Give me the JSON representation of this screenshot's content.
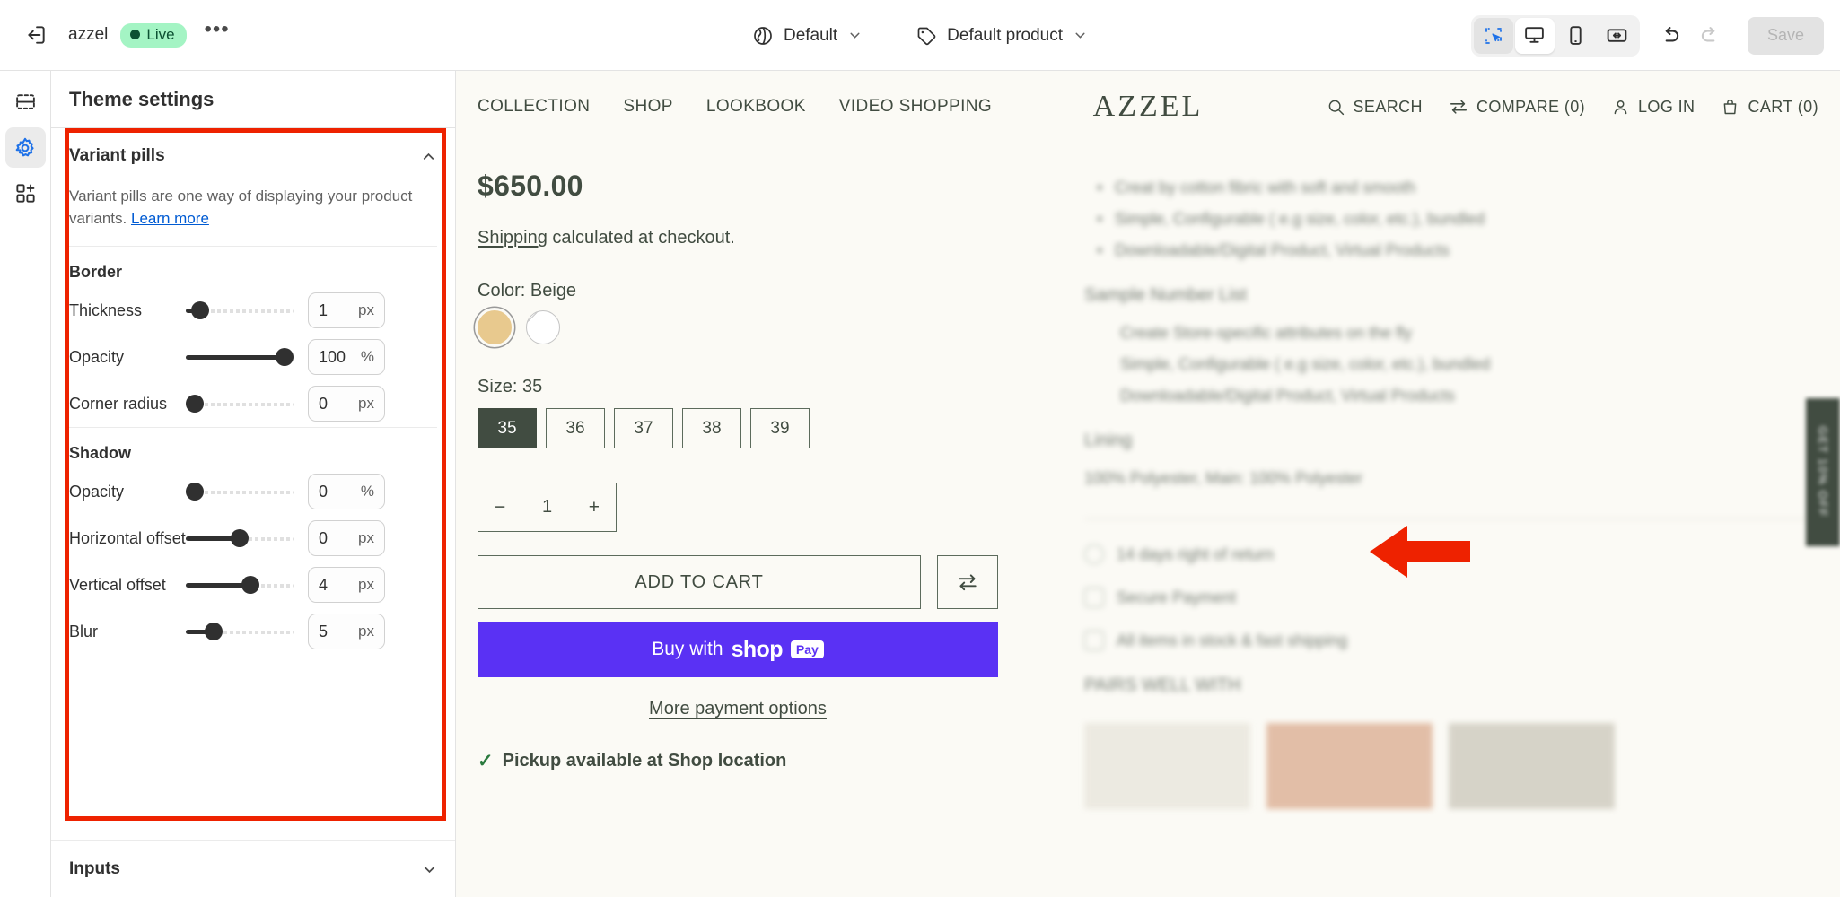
{
  "topbar": {
    "exit_icon": "exit-icon",
    "shop_name": "azzel",
    "live_label": "Live",
    "more_label": "•••",
    "theme_selector": {
      "icon": "globe-icon",
      "label": "Default",
      "chevron": "chevron-down-icon"
    },
    "template_selector": {
      "icon": "tag-icon",
      "label": "Default product",
      "chevron": "chevron-down-icon"
    },
    "view_buttons": [
      {
        "name": "inspect-icon",
        "state": "active"
      },
      {
        "name": "desktop-icon",
        "state": "selected"
      },
      {
        "name": "mobile-icon",
        "state": "default"
      },
      {
        "name": "fullwidth-icon",
        "state": "default"
      }
    ],
    "undo_icon": "undo-icon",
    "redo_icon": "redo-icon",
    "save_label": "Save",
    "save_disabled": true
  },
  "rail": {
    "items": [
      {
        "name": "sections-icon",
        "active": false
      },
      {
        "name": "gear-icon",
        "active": true
      },
      {
        "name": "apps-add-icon",
        "active": false
      }
    ]
  },
  "panel": {
    "title": "Theme settings",
    "section": {
      "title": "Variant pills",
      "collapse_icon": "chevron-up-icon",
      "description_before": "Variant pills are one way of displaying your product variants. ",
      "learn_more": "Learn more",
      "groups": [
        {
          "label": "Border",
          "rows": [
            {
              "label": "Thickness",
              "value": "1",
              "unit": "px",
              "fill_pct": 13
            },
            {
              "label": "Opacity",
              "value": "100",
              "unit": "%",
              "fill_pct": 100
            },
            {
              "label": "Corner radius",
              "value": "0",
              "unit": "px",
              "fill_pct": 0
            }
          ]
        },
        {
          "label": "Shadow",
          "rows": [
            {
              "label": "Opacity",
              "value": "0",
              "unit": "%",
              "fill_pct": 0
            },
            {
              "label": "Horizontal offset",
              "value": "0",
              "unit": "px",
              "fill_pct": 50
            },
            {
              "label": "Vertical offset",
              "value": "4",
              "unit": "px",
              "fill_pct": 60
            },
            {
              "label": "Blur",
              "value": "5",
              "unit": "px",
              "fill_pct": 26
            }
          ]
        }
      ]
    },
    "next_section": {
      "title": "Inputs",
      "expand_icon": "chevron-down-icon"
    }
  },
  "annotations": {
    "highlight_box_color": "#ee2200",
    "arrow_color": "#ee2200",
    "arrow_points_to": "size-pills"
  },
  "store": {
    "nav": [
      "COLLECTION",
      "SHOP",
      "LOOKBOOK",
      "VIDEO SHOPPING"
    ],
    "logo": "AZZEL",
    "utilities": [
      {
        "icon": "search-icon",
        "label": "SEARCH"
      },
      {
        "icon": "compare-icon",
        "label": "COMPARE (0)"
      },
      {
        "icon": "user-icon",
        "label": "LOG IN"
      },
      {
        "icon": "bag-icon",
        "label": "CART (0)"
      }
    ],
    "product": {
      "price": "$650.00",
      "shipping_link": "Shipping",
      "shipping_rest": " calculated at checkout.",
      "color_label": "Color: Beige",
      "color_swatches": [
        {
          "name": "beige-swatch",
          "color": "#e8c98e",
          "selected": true
        },
        {
          "name": "unavailable-swatch",
          "color": "#ffffff",
          "selected": false
        }
      ],
      "size_label": "Size: 35",
      "sizes": [
        "35",
        "36",
        "37",
        "38",
        "39"
      ],
      "selected_size": "35",
      "qty_minus": "−",
      "qty_value": "1",
      "qty_plus": "+",
      "add_to_cart": "ADD TO CART",
      "compare_icon": "compare-arrows-icon",
      "shoppay_prefix": "Buy with",
      "shoppay_logo": "shop",
      "shoppay_tag": "Pay",
      "more_payment": "More payment options",
      "pickup_check": "✓",
      "pickup_text": "Pickup available at Shop location"
    },
    "description_blurred": {
      "bullets": [
        "Creat by cotton fibric with soft and smooth",
        "Simple, Configurable ( e.g size, color, etc.), bundled",
        "Downloadable/Digital Product, Virtual Products"
      ],
      "list_heading": "Sample Number List",
      "numbered": [
        "Create Store-specific attributes on the fly",
        "Simple, Configurable ( e.g size, color, etc.), bundled",
        "Downloadable/Digital Product, Virtual Products"
      ],
      "lining_heading": "Lining",
      "lining_text": "100% Polyester, Main: 100% Polyester",
      "features": [
        "14 days right of return",
        "Secure Payment",
        "All items in stock & fast shipping"
      ],
      "pairs_heading": "PAIRS WELL WITH",
      "side_tab": "GET 10% OFF"
    }
  }
}
